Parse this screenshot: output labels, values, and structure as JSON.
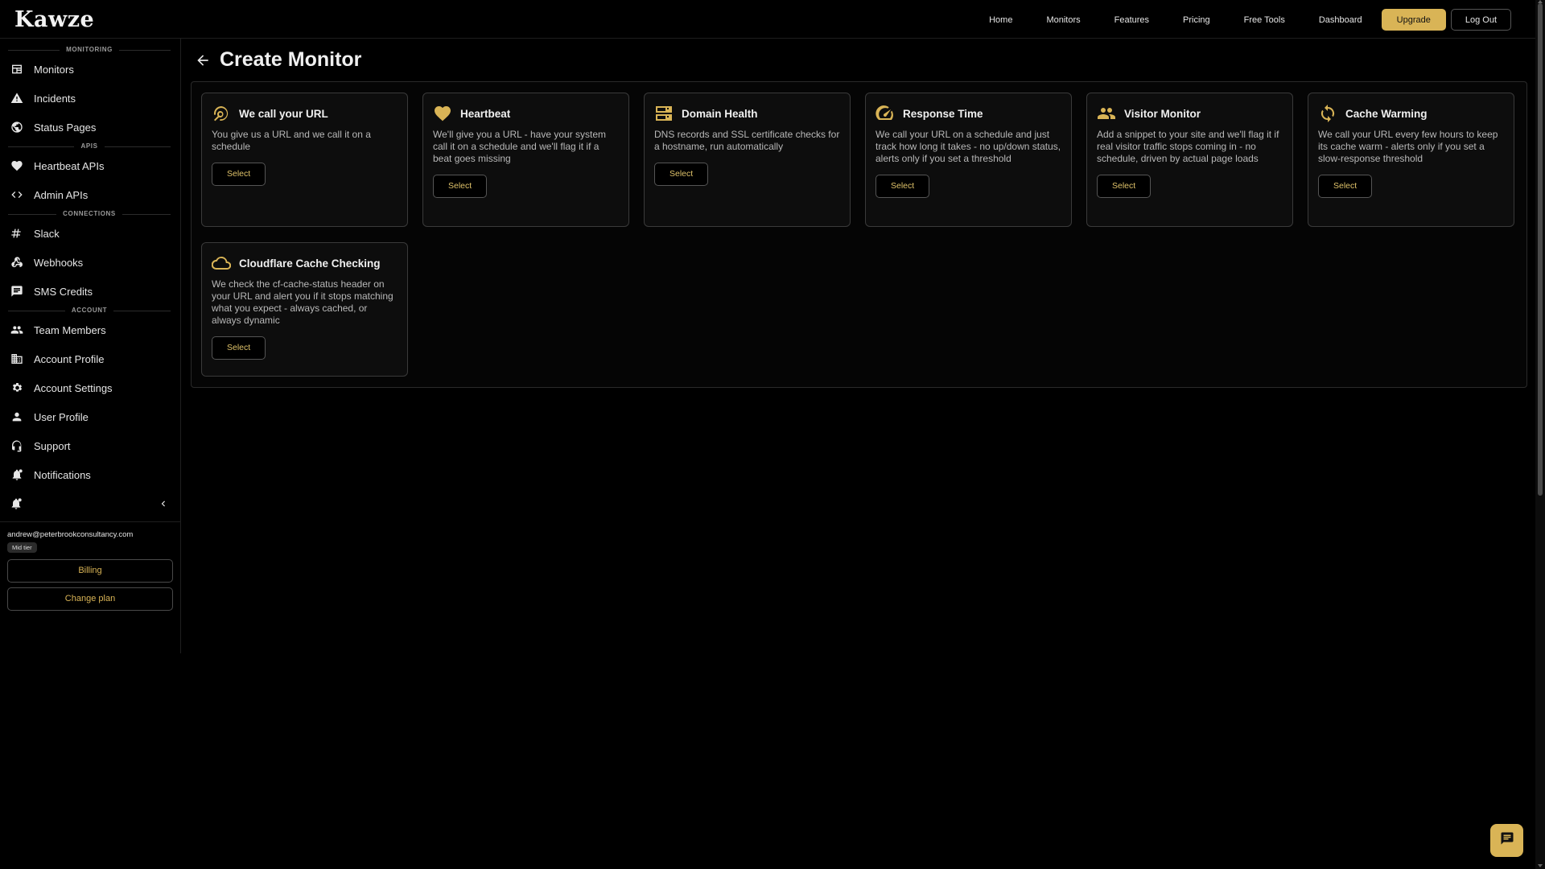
{
  "app": {
    "logo": "Kawze"
  },
  "topnav": {
    "links": [
      "Home",
      "Monitors",
      "Features",
      "Pricing",
      "Free Tools",
      "Dashboard"
    ],
    "upgrade_label": "Upgrade",
    "logout_label": "Log Out"
  },
  "sidebar": {
    "sections": [
      {
        "title": "MONITORING",
        "items": [
          {
            "label": "Monitors",
            "icon": "monitors-icon"
          },
          {
            "label": "Incidents",
            "icon": "warning-icon"
          },
          {
            "label": "Status Pages",
            "icon": "globe-icon"
          }
        ]
      },
      {
        "title": "APIS",
        "items": [
          {
            "label": "Heartbeat APIs",
            "icon": "heart-icon"
          },
          {
            "label": "Admin APIs",
            "icon": "code-icon"
          }
        ]
      },
      {
        "title": "CONNECTIONS",
        "items": [
          {
            "label": "Slack",
            "icon": "hashtag-icon"
          },
          {
            "label": "Webhooks",
            "icon": "webhook-icon"
          },
          {
            "label": "SMS Credits",
            "icon": "chat-icon"
          }
        ]
      },
      {
        "title": "ACCOUNT",
        "items": [
          {
            "label": "Team Members",
            "icon": "team-icon"
          },
          {
            "label": "Account Profile",
            "icon": "building-icon"
          },
          {
            "label": "Account Settings",
            "icon": "gear-icon"
          },
          {
            "label": "User Profile",
            "icon": "user-icon"
          },
          {
            "label": "Support",
            "icon": "support-icon"
          },
          {
            "label": "Notifications",
            "icon": "notification-bell-icon"
          }
        ]
      }
    ],
    "account": {
      "email": "andrew@peterbrookconsultancy.com",
      "tier": "Mid tier",
      "billing_label": "Billing",
      "change_plan_label": "Change plan"
    }
  },
  "main": {
    "title": "Create Monitor",
    "cards": [
      {
        "title": "We call your URL",
        "icon": "url-search-icon",
        "desc": "You give us a URL and we call it on a schedule",
        "button": "Select"
      },
      {
        "title": "Heartbeat",
        "icon": "heart-icon",
        "desc": "We'll give you a URL - have your system call it on a schedule and we'll flag it if a beat goes missing",
        "button": "Select"
      },
      {
        "title": "Domain Health",
        "icon": "server-icon",
        "desc": "DNS records and SSL certificate checks for a hostname, run automatically",
        "button": "Select"
      },
      {
        "title": "Response Time",
        "icon": "speedometer-icon",
        "desc": "We call your URL on a schedule and just track how long it takes - no up/down status, alerts only if you set a threshold",
        "button": "Select"
      },
      {
        "title": "Visitor Monitor",
        "icon": "people-icon",
        "desc": "Add a snippet to your site and we'll flag it if real visitor traffic stops coming in - no schedule, driven by actual page loads",
        "button": "Select"
      },
      {
        "title": "Cache Warming",
        "icon": "refresh-icon",
        "desc": "We call your URL every few hours to keep its cache warm - alerts only if you set a slow-response threshold",
        "button": "Select"
      },
      {
        "title": "Cloudflare Cache Checking",
        "icon": "cloud-icon",
        "desc": "We check the cf-cache-status header on your URL and alert you if it stops matching what you expect - always cached, or always dynamic",
        "button": "Select"
      }
    ]
  },
  "colors": {
    "accent": "#d9b456",
    "background": "#000000",
    "card_bg": "#0d0d0d",
    "border": "#3a3a3a"
  }
}
